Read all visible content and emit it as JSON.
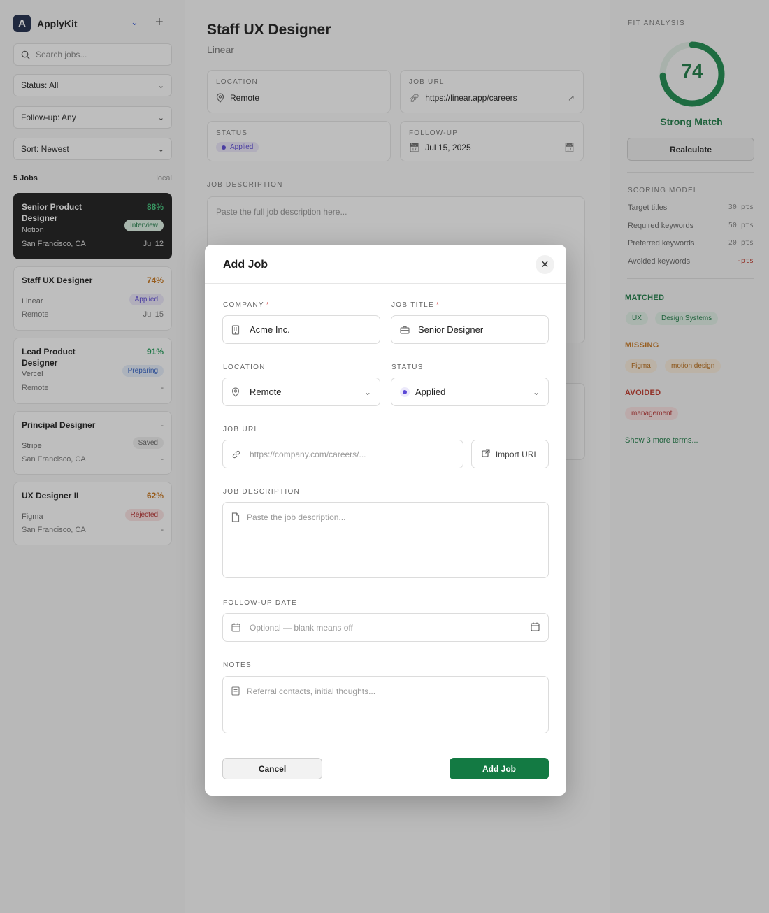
{
  "sidebar": {
    "brand": "ApplyKit",
    "logo_glyph": "A",
    "search_placeholder": "Search jobs...",
    "filters": {
      "status": "Status: All",
      "followup": "Follow-up: Any",
      "sort": "Sort: Newest"
    },
    "count": "5 Jobs",
    "storage": "local",
    "jobs": [
      {
        "title": "Senior Product Designer",
        "company": "Notion",
        "location": "San Francisco, CA",
        "score": "88%",
        "status": "Interview",
        "date": "Jul 12"
      },
      {
        "title": "Staff UX Designer",
        "company": "Linear",
        "location": "Remote",
        "score": "74%",
        "status": "Applied",
        "date": "Jul 15"
      },
      {
        "title": "Lead Product Designer",
        "company": "Vercel",
        "location": "Remote",
        "score": "91%",
        "status": "Preparing",
        "date": "-"
      },
      {
        "title": "Principal Designer",
        "company": "Stripe",
        "location": "San Francisco, CA",
        "score": "-",
        "status": "Saved",
        "date": "-"
      },
      {
        "title": "UX Designer II",
        "company": "Figma",
        "location": "San Francisco, CA",
        "score": "62%",
        "status": "Rejected",
        "date": "-"
      }
    ]
  },
  "main": {
    "title": "Staff UX Designer",
    "company": "Linear",
    "location_label": "LOCATION",
    "location": "Remote",
    "url_label": "JOB URL",
    "url": "https://linear.app/careers",
    "status_label": "STATUS",
    "status": "Applied",
    "followup_label": "FOLLOW-UP",
    "followup": "Jul 15, 2025",
    "desc_label": "JOB DESCRIPTION",
    "desc_placeholder": "Paste the full job description here..."
  },
  "fit": {
    "header": "FIT ANALYSIS",
    "score": "74",
    "score_fraction": 0.74,
    "label": "Strong Match",
    "recalc": "Realculate",
    "scoring_header": "SCORING MODEL",
    "scoring": [
      {
        "name": "Target titles",
        "pts": "30 pts"
      },
      {
        "name": "Required keywords",
        "pts": "50 pts"
      },
      {
        "name": "Preferred keywords",
        "pts": "20 pts"
      },
      {
        "name": "Avoided keywords",
        "pts": "-pts"
      }
    ],
    "matched_header": "MATCHED",
    "matched": [
      "UX",
      "Design Systems"
    ],
    "missing_header": "MISSING",
    "missing": [
      "Figma",
      "motion design"
    ],
    "avoided_header": "AVOIDED",
    "avoided": [
      "management"
    ],
    "show_more": "Show 3 more terms..."
  },
  "modal": {
    "title": "Add Job",
    "company_label": "COMPANY",
    "company_value": "Acme Inc.",
    "title_label": "JOB TITLE",
    "title_value": "Senior Designer",
    "required_mark": "*",
    "location_label": "LOCATION",
    "location_value": "Remote",
    "status_label": "STATUS",
    "status_value": "Applied",
    "url_label": "JOB URL",
    "url_placeholder": "https://company.com/careers/...",
    "import_label": "Import URL",
    "desc_label": "JOB DESCRIPTION",
    "desc_placeholder": "Paste the job description...",
    "followup_label": "FOLLOW-UP DATE",
    "followup_placeholder": "Optional — blank means off",
    "notes_label": "NOTES",
    "notes_placeholder": "Referral contacts, initial thoughts...",
    "cancel": "Cancel",
    "submit": "Add Job"
  },
  "colors": {
    "accent": "#137a43",
    "interview": "#e3f2e8",
    "applied": "#ece9fb",
    "preparing": "#e6eefb",
    "rejected": "#fbe3e3",
    "saved": "#efefef"
  }
}
